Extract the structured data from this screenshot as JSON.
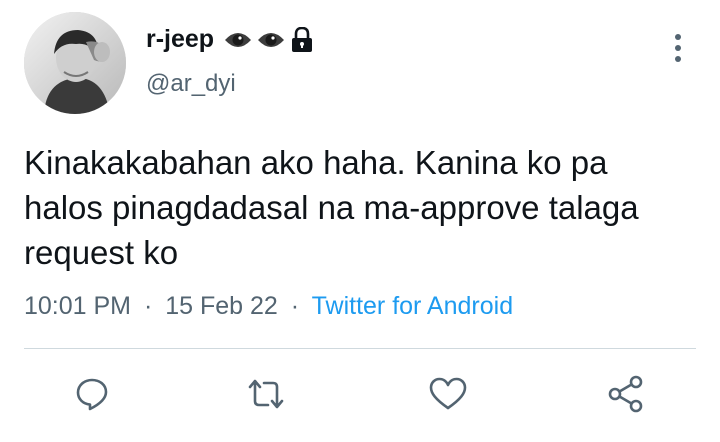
{
  "tweet": {
    "author": {
      "display_name": "r-jeep",
      "handle": "@ar_dyi",
      "name_icons": [
        "eye-icon",
        "eye-icon",
        "lock-icon"
      ]
    },
    "text": "Kinakakabahan ako haha. Kanina ko pa halos pinagdadasal na ma-approve talaga request ko",
    "time": "10:01 PM",
    "date": "15 Feb 22",
    "separator": "·",
    "source": "Twitter for Android"
  },
  "actions": [
    "reply-icon",
    "retweet-icon",
    "like-icon",
    "share-icon"
  ],
  "colors": {
    "text": "#0f1419",
    "secondary": "#536471",
    "link": "#1d9bf0",
    "divider": "#cfd9de"
  }
}
